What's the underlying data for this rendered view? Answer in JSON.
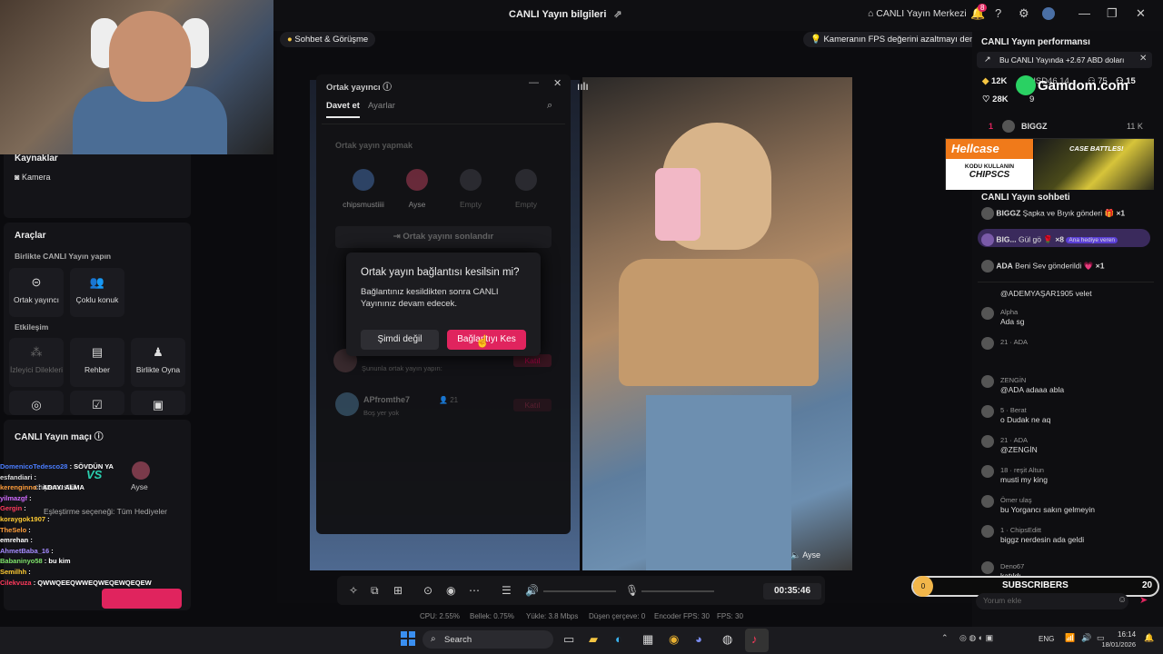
{
  "topbar": {
    "title": "CANLI Yayın bilgileri",
    "live_center": "CANLI Yayın Merkezi",
    "notif_count": "8"
  },
  "left": {
    "kaynaklar": "Kaynaklar",
    "kamera": "Kamera",
    "araclar": "Araçlar",
    "birlikte": "Birlikte CANLI Yayın yapın",
    "tools": [
      "Ortak yayıncı",
      "Çoklu konuk"
    ],
    "etkilesim": "Etkileşim",
    "tools2": [
      "İzleyici Dilekleri",
      "Rehber",
      "Birlikte Oyna"
    ],
    "mac_title": "CANLI Yayın maçı",
    "mac_p1": "chipsmustiiii",
    "mac_p2": "Ayse",
    "mac_opt": "Eşleştirme seçeneği: Tüm Hediyeler"
  },
  "overlay_chat": [
    {
      "u": "DomenicoTedesco28",
      "m": "SÖVDÜN YA",
      "c": "#4a7dff"
    },
    {
      "u": "esfandiari",
      "m": "",
      "c": "#ddd"
    },
    {
      "u": "kerenginno",
      "m": "ADAYI ALMA",
      "c": "#ff9d3a"
    },
    {
      "u": "yilmazgf",
      "m": "",
      "c": "#d26bff"
    },
    {
      "u": "Gergin",
      "m": "",
      "c": "#ff3a5c"
    },
    {
      "u": "koraygok1907",
      "m": "",
      "c": "#ffcc33"
    },
    {
      "u": "TheSelo",
      "m": "",
      "c": "#ff9d3a"
    },
    {
      "u": "emrehan",
      "m": "",
      "c": "#fff"
    },
    {
      "u": "AhmetBaba_16",
      "m": "",
      "c": "#a58bff"
    },
    {
      "u": "Babaninyo58",
      "m": "bu kim",
      "c": "#7fe36b"
    },
    {
      "u": "Semilhh",
      "m": "",
      "c": "#ffcc33"
    },
    {
      "u": "Cilekvuza",
      "m": "QWWQEEQWWEQWEQEWQEQEW",
      "c": "#ff3a5c"
    }
  ],
  "pills": {
    "left": "Sohbet & Görüşme",
    "right": "Kameranın FPS değerini azaltmayı deneyin"
  },
  "cohost": {
    "title": "Ortak yayıncı",
    "tab_invite": "Davet et",
    "tab_settings": "Ayarlar",
    "section": "Ortak yayın yapmak",
    "slots": [
      "chipsmustiiii",
      "Ayse",
      "Empty",
      "Empty"
    ],
    "end": "Ortak yayını sonlandır",
    "row_sub": "Şununla ortak yayın yapın:",
    "join": "Katıl",
    "user": "APfromthe7",
    "user_count": "21",
    "user_sub": "Boş yer yok"
  },
  "dialog": {
    "title": "Ortak yayın bağlantısı kesilsin mi?",
    "body": "Bağlantınız kesildikten sonra CANLI Yayınınız devam edecek.",
    "cancel": "Şimdi değil",
    "confirm": "Bağlantıyı Kes"
  },
  "video": {
    "guest_label": "Ayse"
  },
  "toolbar": {
    "time": "00:35:46"
  },
  "stats": [
    "CPU: 2.55%",
    "Bellek: 0.75%",
    "Yükle: 3.8 Mbps",
    "Düşen çerçeve: 0",
    "Encoder FPS: 30",
    "FPS: 30"
  ],
  "right": {
    "perf_title": "CANLI Yayın performansı",
    "banner": "Bu CANLI Yayında +2.67 ABD doları",
    "stats": [
      "12K",
      "USD46.14",
      "75",
      "15",
      "28K",
      "9"
    ],
    "gamdom": "Gamdom.com",
    "rank": "1",
    "rank_user": "BIGGZ",
    "rank_val": "11 K",
    "hellcase": {
      "brand": "Hellcase",
      "code_label": "KODU KULLANIN",
      "code": "CHIPSCS",
      "battles": "CASE BATTLES!"
    },
    "chat_title": "CANLI Yayın sohbeti",
    "gifts": [
      {
        "u": "BIGGZ",
        "t": "Şapka ve Bıyık gönderi",
        "x": "×1"
      },
      {
        "u": "BIG...",
        "t": "Gül gö",
        "x": "×8",
        "tag": "Ana hediye veren"
      },
      {
        "u": "ADA",
        "t": "Beni Sev gönderildi",
        "x": "×1"
      }
    ],
    "messages": [
      {
        "n": "",
        "t": "@ADEMYAŞAR1905 velet"
      },
      {
        "n": "Alpha",
        "t": "Ada sg"
      },
      {
        "n": "21 · ADA",
        "t": ""
      },
      {
        "n": "ZENGİN",
        "t": "@ADA adaaa abla"
      },
      {
        "n": "5 · Berat",
        "t": "o Dudak ne aq"
      },
      {
        "n": "21 · ADA",
        "t": "@ZENGİN"
      },
      {
        "n": "18 · reşit Altun",
        "t": "musti my king"
      },
      {
        "n": "Ömer ulaş",
        "t": "bu Yorgancı sakın gelmeyin"
      },
      {
        "n": "1 · ChipsEditt",
        "t": "biggz nerdesin ada geldi"
      },
      {
        "n": "Deno67",
        "t": "katıldı"
      }
    ],
    "comment_ph": "Yorum ekle"
  },
  "subs": {
    "left": "0",
    "label": "SUBSCRIBERS",
    "right": "20"
  },
  "taskbar": {
    "search": "Search",
    "lang": "ENG",
    "time": "16:14",
    "date": "18/01/2026"
  }
}
